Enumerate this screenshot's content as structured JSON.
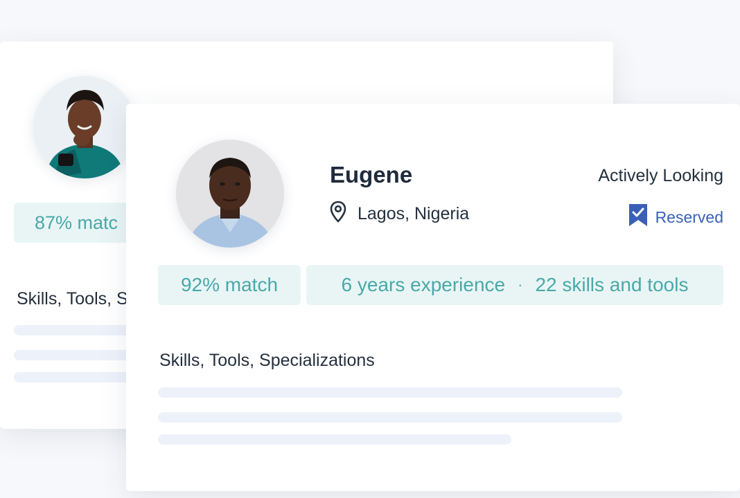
{
  "back_card": {
    "match_label": "87% matc",
    "section_title": "Skills, Tools, S"
  },
  "front_card": {
    "name": "Eugene",
    "location": "Lagos, Nigeria",
    "status": "Actively Looking",
    "reserved_label": "Reserved",
    "match_label": "92% match",
    "experience_label": "6 years experience",
    "separator": "·",
    "skills_label": "22 skills and tools",
    "section_title": "Skills, Tools, Specializations"
  },
  "colors": {
    "accent_teal": "#4aa8a8",
    "pill_bg": "#e9f5f5",
    "reserved_blue": "#3a5fb8",
    "text_dark": "#24303e",
    "placeholder_bar": "#edf1fa"
  },
  "icons": {
    "location": "map-pin-icon",
    "reserved": "bookmark-check-icon"
  }
}
